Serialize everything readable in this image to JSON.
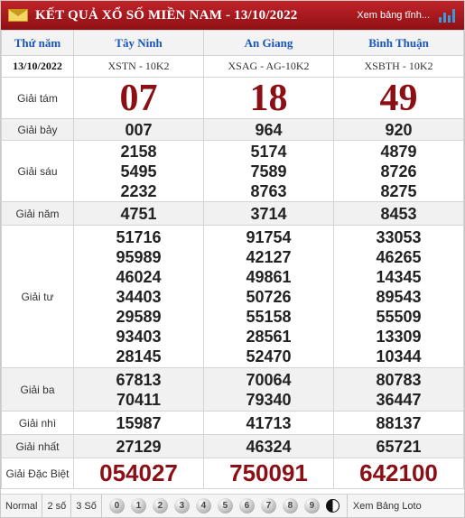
{
  "header": {
    "title": "KẾT QUẢ XỔ SỐ MIỀN NAM - 13/10/2022",
    "more_link": "Xem bảng tĩnh..."
  },
  "table": {
    "day_header": "Thứ năm",
    "date": "13/10/2022",
    "provinces": [
      {
        "name": "Tây Ninh",
        "code": "XSTN - 10K2"
      },
      {
        "name": "An Giang",
        "code": "XSAG - AG-10K2"
      },
      {
        "name": "Bình Thuận",
        "code": "XSBTH - 10K2"
      }
    ],
    "prizes": [
      {
        "label": "Giải tám",
        "values": [
          [
            "07"
          ],
          [
            "18"
          ],
          [
            "49"
          ]
        ]
      },
      {
        "label": "Giải bảy",
        "values": [
          [
            "007"
          ],
          [
            "964"
          ],
          [
            "920"
          ]
        ]
      },
      {
        "label": "Giải sáu",
        "values": [
          [
            "2158",
            "5495",
            "2232"
          ],
          [
            "5174",
            "7589",
            "8763"
          ],
          [
            "4879",
            "8726",
            "8275"
          ]
        ]
      },
      {
        "label": "Giải năm",
        "values": [
          [
            "4751"
          ],
          [
            "3714"
          ],
          [
            "8453"
          ]
        ]
      },
      {
        "label": "Giải tư",
        "values": [
          [
            "51716",
            "95989",
            "46024",
            "34403",
            "29589",
            "93403",
            "28145"
          ],
          [
            "91754",
            "42127",
            "49861",
            "50726",
            "55158",
            "28561",
            "52470"
          ],
          [
            "33053",
            "46265",
            "14345",
            "89543",
            "55509",
            "13309",
            "10344"
          ]
        ]
      },
      {
        "label": "Giải ba",
        "values": [
          [
            "67813",
            "70411"
          ],
          [
            "70064",
            "79340"
          ],
          [
            "80783",
            "36447"
          ]
        ]
      },
      {
        "label": "Giải nhì",
        "values": [
          [
            "15987"
          ],
          [
            "41713"
          ],
          [
            "88137"
          ]
        ]
      },
      {
        "label": "Giải nhất",
        "values": [
          [
            "27129"
          ],
          [
            "46324"
          ],
          [
            "65721"
          ]
        ]
      },
      {
        "label": "Giải Đặc Biệt",
        "values": [
          [
            "054027"
          ],
          [
            "750091"
          ],
          [
            "642100"
          ]
        ]
      }
    ]
  },
  "footer": {
    "normal_label": "Normal",
    "two_digit_label": "2 số",
    "three_digit_label": "3 Số",
    "digits": [
      "0",
      "1",
      "2",
      "3",
      "4",
      "5",
      "6",
      "7",
      "8",
      "9"
    ],
    "loto_label": "Xem Bảng Loto"
  }
}
